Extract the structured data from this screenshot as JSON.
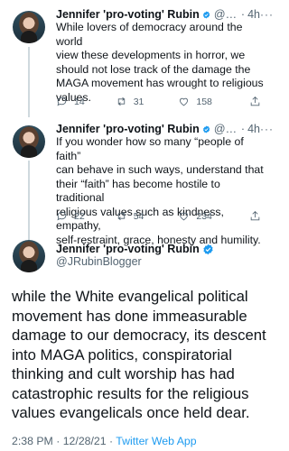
{
  "tweets": [
    {
      "name": "Jennifer 'pro-voting' Rubin",
      "handle": "@JR...",
      "sep": "·",
      "time": "4h",
      "more": "···",
      "lines": [
        "While lovers of democracy around the world",
        "view these developments in horror, we",
        "should not lose track of the damage the",
        "MAGA movement has wrought to religious",
        "values."
      ],
      "replies": "14",
      "retweets": "31",
      "likes": "158"
    },
    {
      "name": "Jennifer 'pro-voting' Rubin",
      "handle": "@JR...",
      "sep": "·",
      "time": "4h",
      "more": "···",
      "lines": [
        "If you wonder how so many “people of faith”",
        "can behave in such ways, understand that",
        "their “faith” has become hostile to traditional",
        "religious values such as kindness, empathy,",
        "self-restraint, grace, honesty and humility."
      ],
      "replies": "22",
      "retweets": "54",
      "likes": "234"
    }
  ],
  "main": {
    "name": "Jennifer 'pro-voting' Rubin",
    "handle": "@JRubinBlogger",
    "lines": [
      "while the White evangelical political",
      "movement has done immeasurable",
      "damage to our democracy, its descent",
      "into MAGA politics, conspiratorial",
      "thinking and cult worship has had",
      "catastrophic results for the religious",
      "values evangelicals once held dear."
    ],
    "timestamp": "2:38 PM · 12/28/21 · ",
    "source": "Twitter Web App"
  },
  "colors": {
    "accent": "#1d9bf0",
    "secondary_text": "#536471",
    "text": "#0f1419"
  },
  "icons": [
    "reply-icon",
    "retweet-icon",
    "like-icon",
    "share-icon",
    "verified-badge-icon"
  ]
}
